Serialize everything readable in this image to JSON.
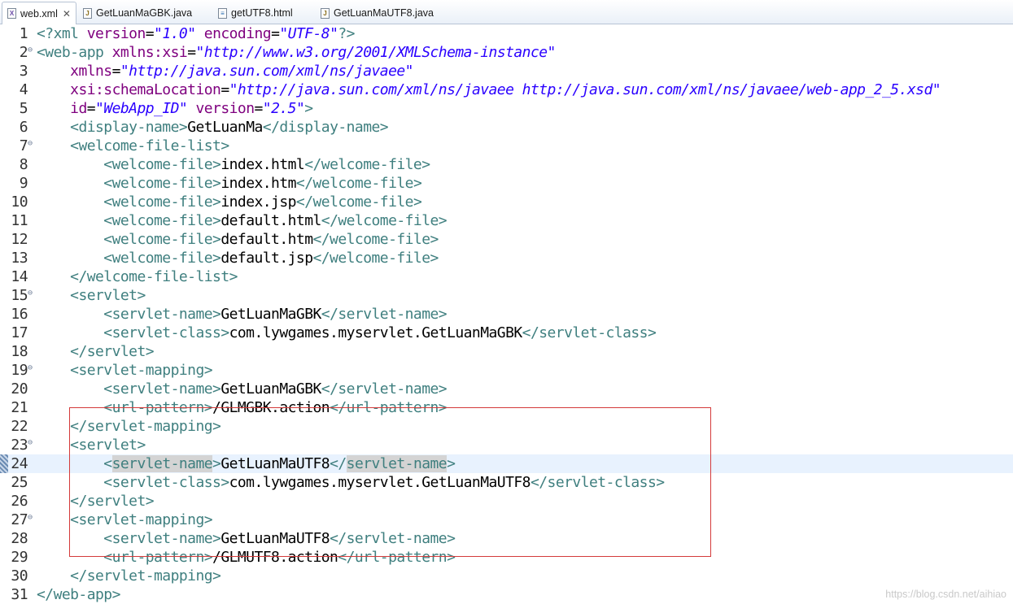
{
  "tabs": [
    {
      "label": "web.xml",
      "icon": "xml-file-icon",
      "active": true
    },
    {
      "label": "GetLuanMaGBK.java",
      "icon": "java-file-icon",
      "active": false
    },
    {
      "label": "getUTF8.html",
      "icon": "html-file-icon",
      "active": false
    },
    {
      "label": "GetLuanMaUTF8.java",
      "icon": "java-file-icon",
      "active": false
    }
  ],
  "editor": {
    "current_line": 24,
    "highlight_box_lines": [
      23,
      30
    ],
    "lines": [
      {
        "n": "1",
        "segs": [
          [
            "t",
            "<?"
          ],
          [
            "t",
            "xml "
          ],
          [
            "a",
            "version"
          ],
          [
            "x",
            "="
          ],
          [
            "v",
            "\"1.0\""
          ],
          [
            "x",
            " "
          ],
          [
            "a",
            "encoding"
          ],
          [
            "x",
            "="
          ],
          [
            "v",
            "\"UTF-8\""
          ],
          [
            "t",
            "?>"
          ]
        ]
      },
      {
        "n": "2",
        "fold": true,
        "segs": [
          [
            "t",
            "<web-app "
          ],
          [
            "a",
            "xmlns:xsi"
          ],
          [
            "x",
            "="
          ],
          [
            "v",
            "\"http://www.w3.org/2001/XMLSchema-instance\""
          ]
        ]
      },
      {
        "n": "3",
        "segs": [
          [
            "x",
            "    "
          ],
          [
            "a",
            "xmlns"
          ],
          [
            "x",
            "="
          ],
          [
            "v",
            "\"http://java.sun.com/xml/ns/javaee\""
          ]
        ]
      },
      {
        "n": "4",
        "segs": [
          [
            "x",
            "    "
          ],
          [
            "a",
            "xsi:schemaLocation"
          ],
          [
            "x",
            "="
          ],
          [
            "v",
            "\"http://java.sun.com/xml/ns/javaee http://java.sun.com/xml/ns/javaee/web-app_2_5.xsd\""
          ]
        ]
      },
      {
        "n": "5",
        "segs": [
          [
            "x",
            "    "
          ],
          [
            "a",
            "id"
          ],
          [
            "x",
            "="
          ],
          [
            "v",
            "\"WebApp_ID\""
          ],
          [
            "x",
            " "
          ],
          [
            "a",
            "version"
          ],
          [
            "x",
            "="
          ],
          [
            "v",
            "\"2.5\""
          ],
          [
            "t",
            ">"
          ]
        ]
      },
      {
        "n": "6",
        "segs": [
          [
            "x",
            "    "
          ],
          [
            "t",
            "<display-name>"
          ],
          [
            "x",
            "GetLuanMa"
          ],
          [
            "t",
            "</display-name>"
          ]
        ]
      },
      {
        "n": "7",
        "fold": true,
        "segs": [
          [
            "x",
            "    "
          ],
          [
            "t",
            "<welcome-file-list>"
          ]
        ]
      },
      {
        "n": "8",
        "segs": [
          [
            "x",
            "        "
          ],
          [
            "t",
            "<welcome-file>"
          ],
          [
            "x",
            "index.html"
          ],
          [
            "t",
            "</welcome-file>"
          ]
        ]
      },
      {
        "n": "9",
        "segs": [
          [
            "x",
            "        "
          ],
          [
            "t",
            "<welcome-file>"
          ],
          [
            "x",
            "index.htm"
          ],
          [
            "t",
            "</welcome-file>"
          ]
        ]
      },
      {
        "n": "10",
        "segs": [
          [
            "x",
            "        "
          ],
          [
            "t",
            "<welcome-file>"
          ],
          [
            "x",
            "index.jsp"
          ],
          [
            "t",
            "</welcome-file>"
          ]
        ]
      },
      {
        "n": "11",
        "segs": [
          [
            "x",
            "        "
          ],
          [
            "t",
            "<welcome-file>"
          ],
          [
            "x",
            "default.html"
          ],
          [
            "t",
            "</welcome-file>"
          ]
        ]
      },
      {
        "n": "12",
        "segs": [
          [
            "x",
            "        "
          ],
          [
            "t",
            "<welcome-file>"
          ],
          [
            "x",
            "default.htm"
          ],
          [
            "t",
            "</welcome-file>"
          ]
        ]
      },
      {
        "n": "13",
        "segs": [
          [
            "x",
            "        "
          ],
          [
            "t",
            "<welcome-file>"
          ],
          [
            "x",
            "default.jsp"
          ],
          [
            "t",
            "</welcome-file>"
          ]
        ]
      },
      {
        "n": "14",
        "segs": [
          [
            "x",
            "    "
          ],
          [
            "t",
            "</welcome-file-list>"
          ]
        ]
      },
      {
        "n": "15",
        "fold": true,
        "segs": [
          [
            "x",
            "    "
          ],
          [
            "t",
            "<servlet>"
          ]
        ]
      },
      {
        "n": "16",
        "segs": [
          [
            "x",
            "        "
          ],
          [
            "t",
            "<servlet-name>"
          ],
          [
            "x",
            "GetLuanMaGBK"
          ],
          [
            "t",
            "</servlet-name>"
          ]
        ]
      },
      {
        "n": "17",
        "segs": [
          [
            "x",
            "        "
          ],
          [
            "t",
            "<servlet-class>"
          ],
          [
            "x",
            "com.lywgames.myservlet.GetLuanMaGBK"
          ],
          [
            "t",
            "</servlet-class>"
          ]
        ]
      },
      {
        "n": "18",
        "segs": [
          [
            "x",
            "    "
          ],
          [
            "t",
            "</servlet>"
          ]
        ]
      },
      {
        "n": "19",
        "fold": true,
        "segs": [
          [
            "x",
            "    "
          ],
          [
            "t",
            "<servlet-mapping>"
          ]
        ]
      },
      {
        "n": "20",
        "segs": [
          [
            "x",
            "        "
          ],
          [
            "t",
            "<servlet-name>"
          ],
          [
            "x",
            "GetLuanMaGBK"
          ],
          [
            "t",
            "</servlet-name>"
          ]
        ]
      },
      {
        "n": "21",
        "segs": [
          [
            "x",
            "        "
          ],
          [
            "t",
            "<url-pattern>"
          ],
          [
            "x",
            "/GLMGBK.action"
          ],
          [
            "t",
            "</url-pattern>"
          ]
        ]
      },
      {
        "n": "22",
        "segs": [
          [
            "x",
            "    "
          ],
          [
            "t",
            "</servlet-mapping>"
          ]
        ]
      },
      {
        "n": "23",
        "fold": true,
        "segs": [
          [
            "x",
            "    "
          ],
          [
            "t",
            "<servlet>"
          ]
        ]
      },
      {
        "n": "24",
        "segs": [
          [
            "x",
            "        "
          ],
          [
            "t",
            "<"
          ],
          [
            "th",
            "servlet-name"
          ],
          [
            "t",
            ">"
          ],
          [
            "x",
            "GetLuanMaUTF8"
          ],
          [
            "t",
            "</"
          ],
          [
            "th",
            "servlet-name"
          ],
          [
            "t",
            ">"
          ]
        ]
      },
      {
        "n": "25",
        "segs": [
          [
            "x",
            "        "
          ],
          [
            "t",
            "<servlet-class>"
          ],
          [
            "x",
            "com.lywgames.myservlet.GetLuanMaUTF8"
          ],
          [
            "t",
            "</servlet-class>"
          ]
        ]
      },
      {
        "n": "26",
        "segs": [
          [
            "x",
            "    "
          ],
          [
            "t",
            "</servlet>"
          ]
        ]
      },
      {
        "n": "27",
        "fold": true,
        "segs": [
          [
            "x",
            "    "
          ],
          [
            "t",
            "<servlet-mapping>"
          ]
        ]
      },
      {
        "n": "28",
        "segs": [
          [
            "x",
            "        "
          ],
          [
            "t",
            "<servlet-name>"
          ],
          [
            "x",
            "GetLuanMaUTF8"
          ],
          [
            "t",
            "</servlet-name>"
          ]
        ]
      },
      {
        "n": "29",
        "segs": [
          [
            "x",
            "        "
          ],
          [
            "t",
            "<url-pattern>"
          ],
          [
            "x",
            "/GLMUTF8.action"
          ],
          [
            "t",
            "</url-pattern>"
          ]
        ]
      },
      {
        "n": "30",
        "segs": [
          [
            "x",
            "    "
          ],
          [
            "t",
            "</servlet-mapping>"
          ]
        ]
      },
      {
        "n": "31",
        "segs": [
          [
            "t",
            "</web-app>"
          ]
        ]
      }
    ]
  },
  "watermark": "https://blog.csdn.net/aihiao"
}
